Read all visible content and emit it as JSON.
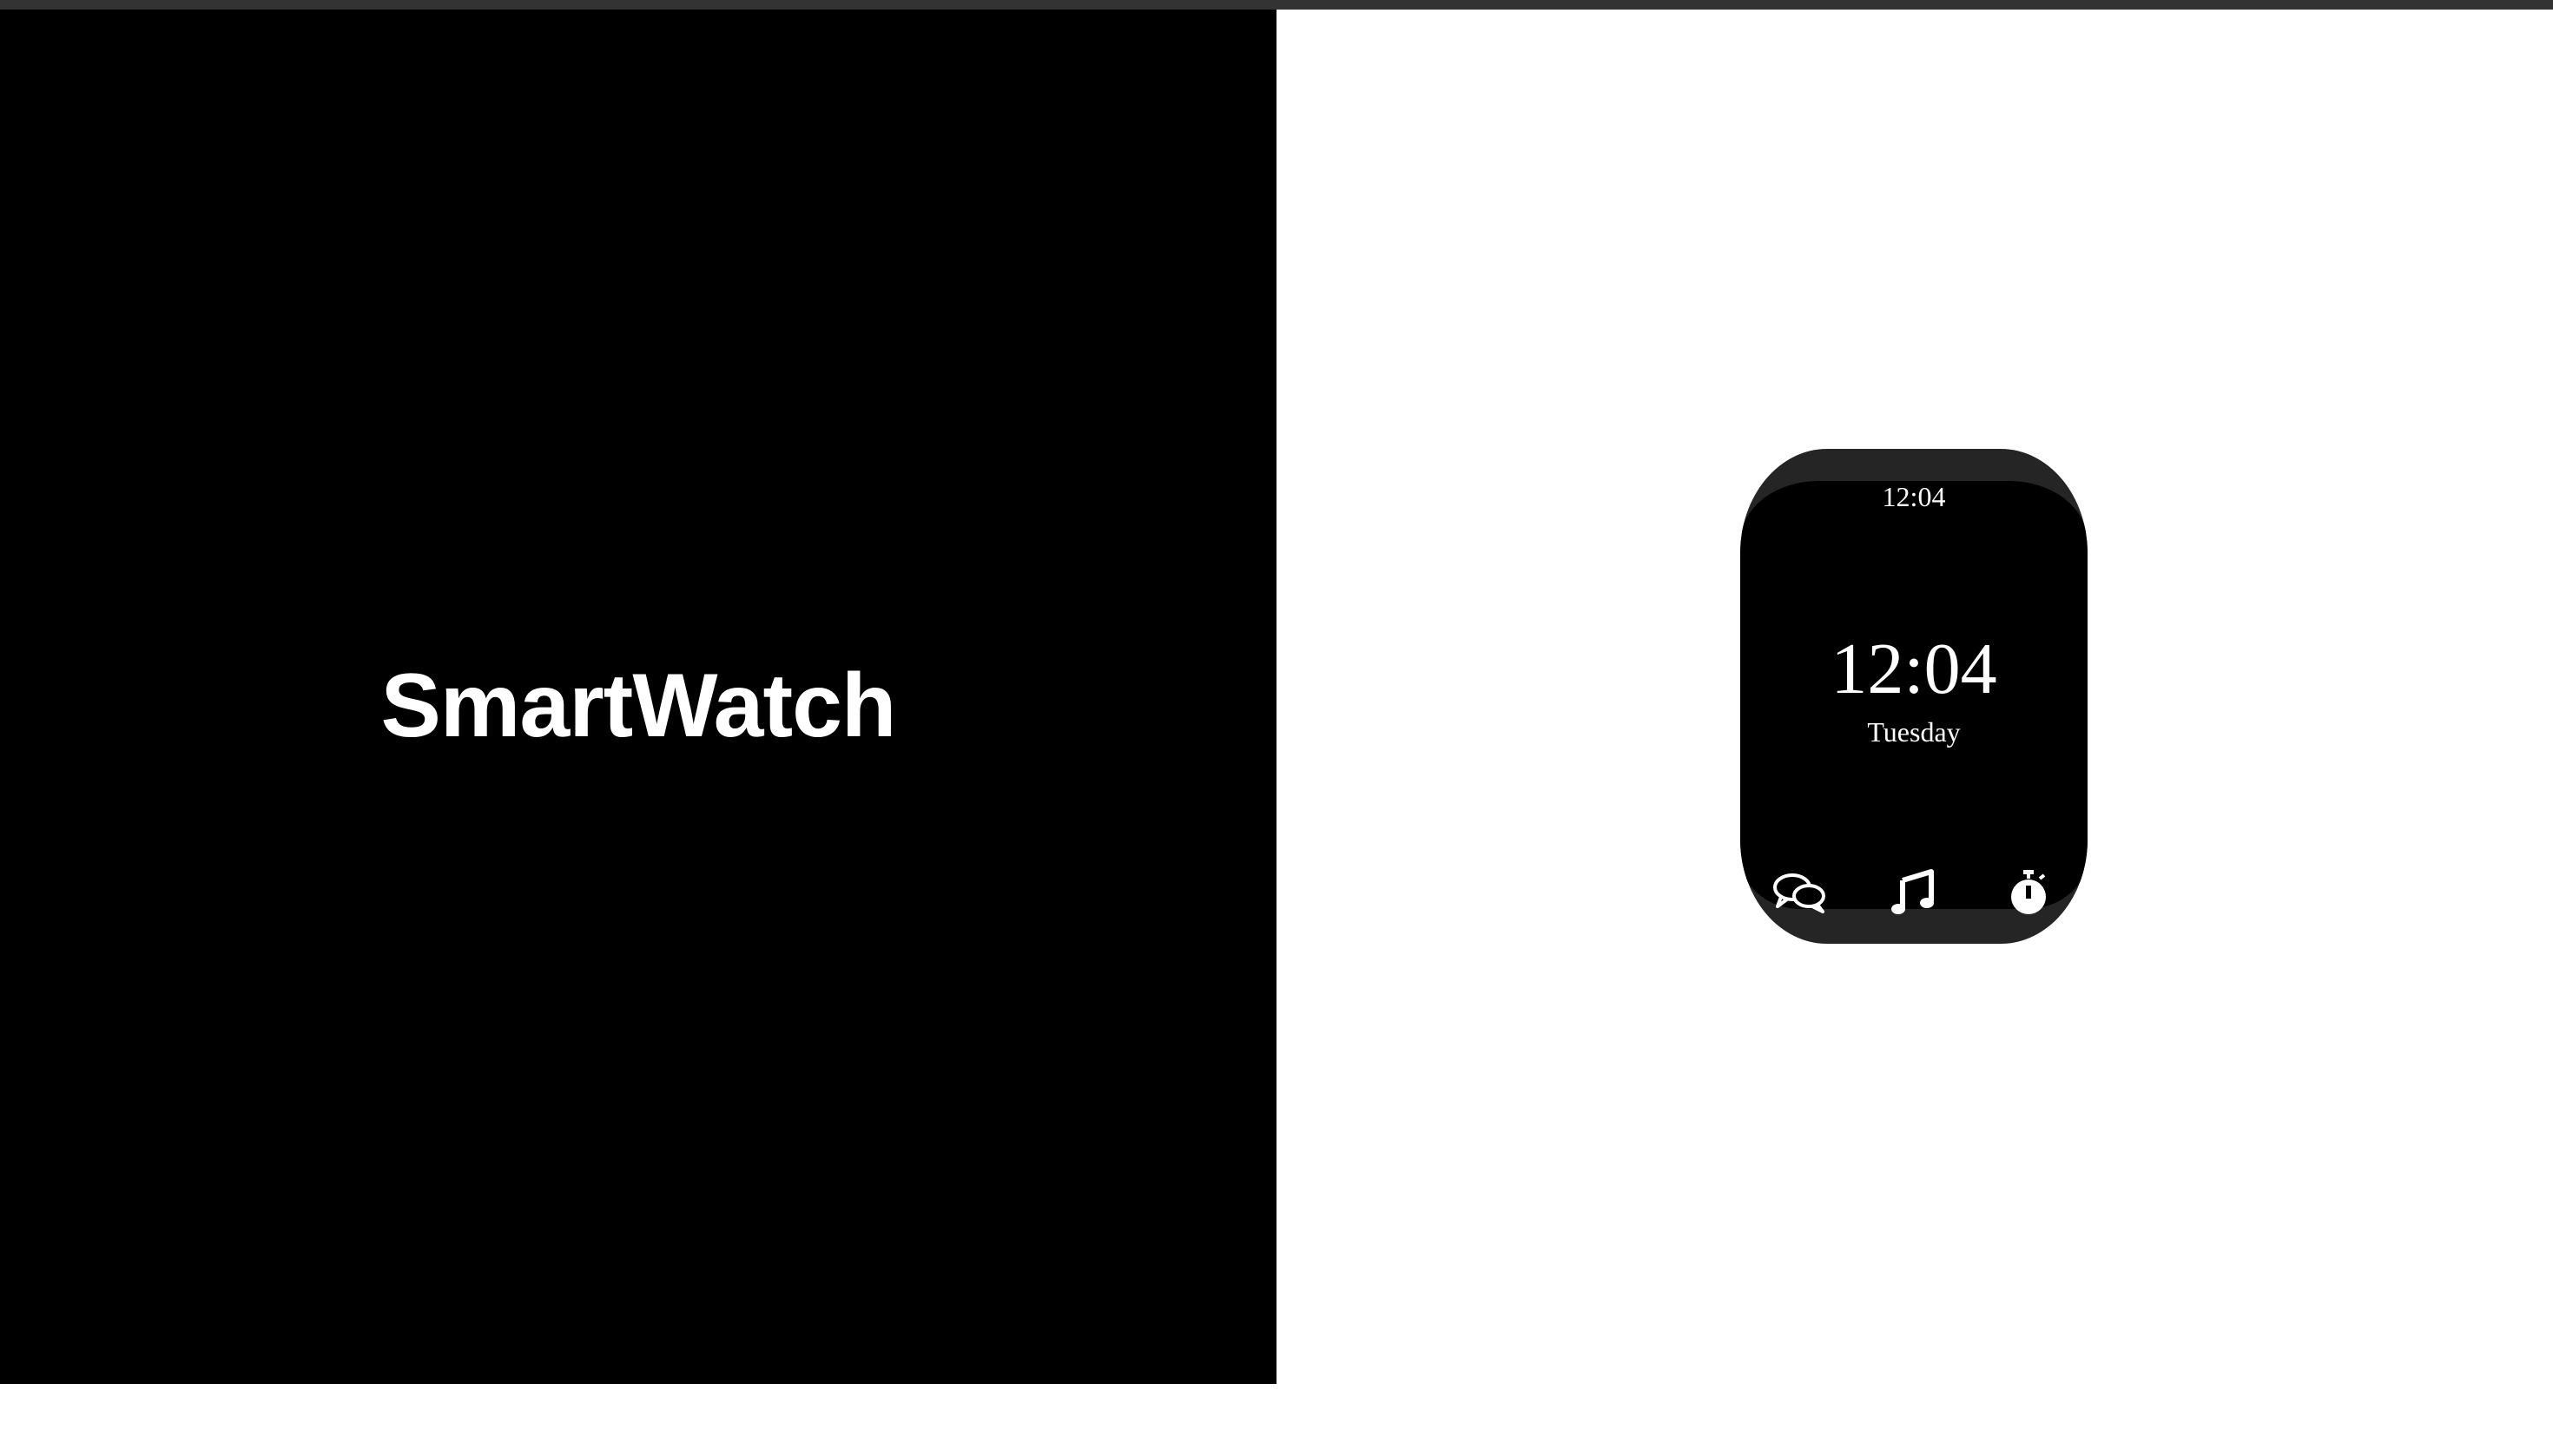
{
  "brand": {
    "title": "SmartWatch"
  },
  "watch": {
    "status_time": "12:04",
    "main_time": "12:04",
    "day": "Tuesday",
    "apps": [
      {
        "name": "messages",
        "icon": "chat-bubbles-icon"
      },
      {
        "name": "music",
        "icon": "music-note-icon"
      },
      {
        "name": "stopwatch",
        "icon": "stopwatch-icon"
      }
    ]
  },
  "colors": {
    "left_background": "#000000",
    "right_background": "#ffffff",
    "watch_frame": "#252525",
    "watch_screen": "#000000",
    "text": "#ffffff",
    "topbar": "#333333"
  }
}
